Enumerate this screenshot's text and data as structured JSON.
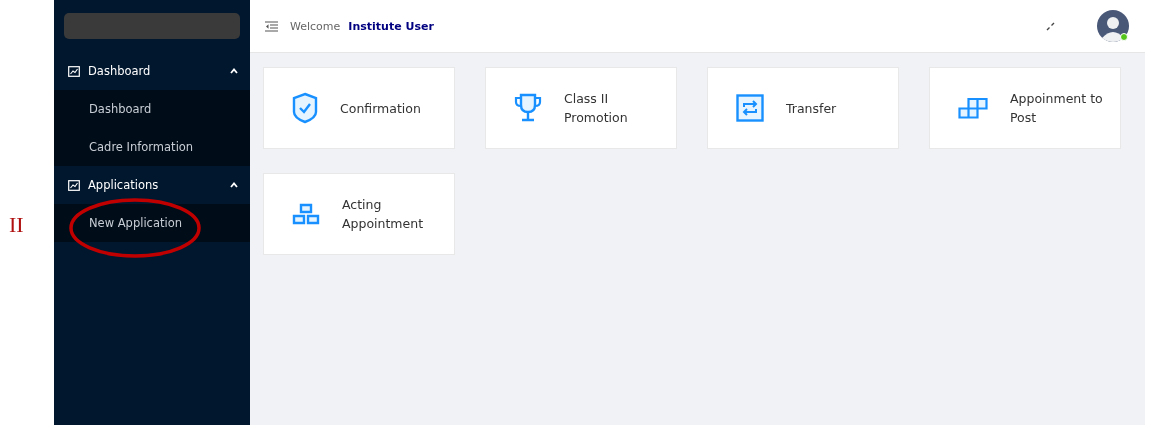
{
  "annotation": {
    "label": "II",
    "ring": true
  },
  "header": {
    "welcome": "Welcome",
    "user": "Institute User",
    "online": true
  },
  "sidebar": {
    "groups": [
      {
        "label": "Dashboard",
        "expanded": true,
        "children": [
          {
            "label": "Dashboard"
          },
          {
            "label": "Cadre Information"
          }
        ]
      },
      {
        "label": "Applications",
        "expanded": true,
        "children": [
          {
            "label": "New Application"
          }
        ]
      }
    ]
  },
  "cards": [
    {
      "kind": "shield",
      "title": "Confirmation"
    },
    {
      "kind": "trophy",
      "title": "Class II Promotion"
    },
    {
      "kind": "swap",
      "title": "Transfer"
    },
    {
      "kind": "blocks",
      "title": "Appoinment to Post"
    },
    {
      "kind": "stack",
      "title": "Acting Appointment"
    }
  ]
}
